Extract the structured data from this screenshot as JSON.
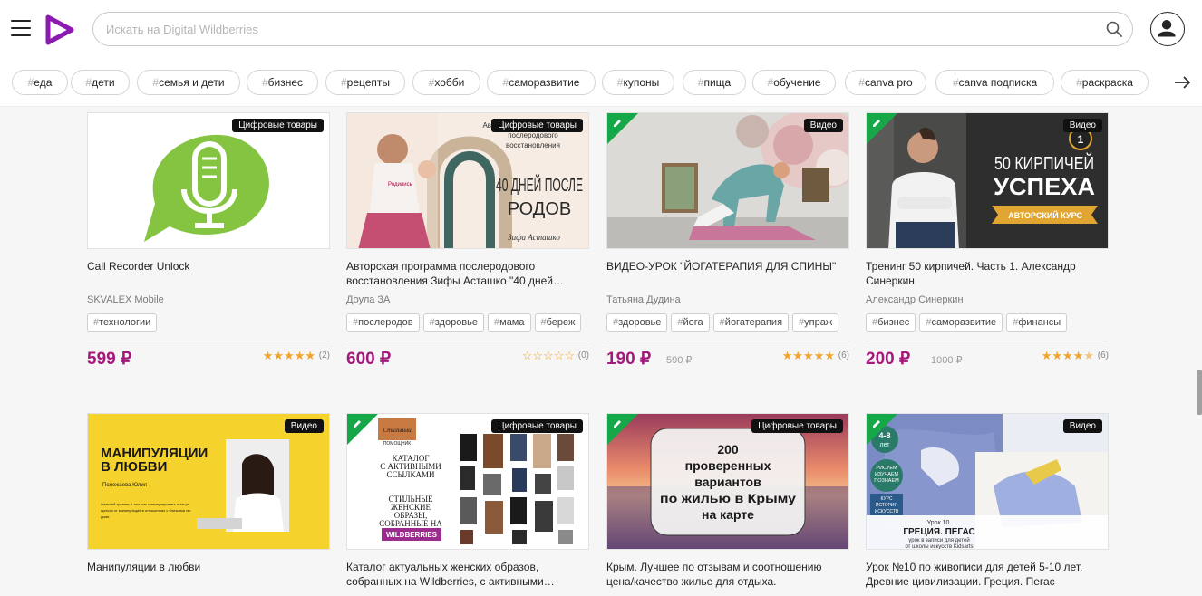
{
  "header": {
    "search_placeholder": "Искать на Digital Wildberries"
  },
  "tags": [
    "еда",
    "дети",
    "семья и дети",
    "бизнес",
    "рецепты",
    "хобби",
    "саморазвитие",
    "купоны",
    "пища",
    "обучение",
    "canva pro",
    "canva подписка",
    "раскраска"
  ],
  "tag_hash": "#",
  "colors": {
    "brand": "#a5197d",
    "logo": "#8b1bb0",
    "new_corner": "#15a748",
    "star": "#f0a42b"
  },
  "cards": [
    {
      "badge": "Цифровые товары",
      "title": "Call Recorder Unlock",
      "author": "SKVALEX Mobile",
      "tags": [
        "технологии"
      ],
      "price": "599 ₽",
      "old_price": "",
      "rating": 5,
      "reviews": "(2)",
      "is_new": false
    },
    {
      "badge": "Цифровые товары",
      "title": "Авторская программа послеродового восстановления Зифы Асташко \"40 дней…",
      "author": "Доула ЗА",
      "tags": [
        "послеродов",
        "здоровье",
        "мама",
        "береж"
      ],
      "price": "600 ₽",
      "old_price": "",
      "rating": 0,
      "reviews": "(0)",
      "is_new": false,
      "thumb_text": {
        "top": "Авторская программа послеродового восстановления",
        "main1": "40 ДНЕЙ ПОСЛЕ",
        "main2": "РОДОВ",
        "sign": "Зифа Асташко",
        "shirt": "Родились"
      }
    },
    {
      "badge": "Видео",
      "title": "ВИДЕО-УРОК \"ЙОГАТЕРАПИЯ ДЛЯ СПИНЫ\"",
      "author": "Татьяна Дудина",
      "tags": [
        "здоровье",
        "йога",
        "йогатерапия",
        "упраж"
      ],
      "price": "190 ₽",
      "old_price": "590 ₽",
      "rating": 5,
      "reviews": "(6)",
      "is_new": true
    },
    {
      "badge": "Видео",
      "title": "Тренинг 50 кирпичей. Часть 1. Александр Синеркин",
      "author": "Александр Синеркин",
      "tags": [
        "бизнес",
        "саморазвитие",
        "финансы"
      ],
      "price": "200 ₽",
      "old_price": "1000 ₽",
      "rating": 4.5,
      "reviews": "(6)",
      "is_new": true,
      "thumb_text": {
        "line1": "50 КИРПИЧЕЙ",
        "line2": "УСПЕХА",
        "ribbon": "АВТОРСКИЙ КУРС",
        "num": "1"
      }
    },
    {
      "badge": "Видео",
      "title": "Манипуляции в любви",
      "author": "",
      "tags": [],
      "price": "",
      "old_price": "",
      "rating": null,
      "reviews": "",
      "is_new": false,
      "thumb_text": {
        "line1": "МАНИПУЛЯЦИИ",
        "line2": "В ЛЮБВИ",
        "name": "Полежаева Юлия",
        "desc": "Женский тренинг о том, как манипулировать и защищаться от манипуляций в отношениях с близкими людьми"
      }
    },
    {
      "badge": "Цифровые товары",
      "title": "Каталог актуальных женских образов, собранных на Wildberries, с активными…",
      "author": "",
      "tags": [],
      "price": "",
      "old_price": "",
      "rating": null,
      "reviews": "",
      "is_new": true,
      "thumb_text": {
        "logo1": "Стильный",
        "logo2": "ПОМОЩНИК",
        "l1": "КАТАЛОГ",
        "l2": "С АКТИВНЫМИ",
        "l3": "ССЫЛКАМИ",
        "s1": "СТИЛЬНЫЕ",
        "s2": "ЖЕНСКИЕ",
        "s3": "ОБРАЗЫ,",
        "s4": "СОБРАННЫЕ НА",
        "wb": "WILDBERRIES"
      }
    },
    {
      "badge": "Цифровые товары",
      "title": "Крым. Лучшее по отзывам и соотношению цена/качество жилье для отдыха.",
      "author": "",
      "tags": [],
      "price": "",
      "old_price": "",
      "rating": null,
      "reviews": "",
      "is_new": true,
      "thumb_text": {
        "l1": "200",
        "l2": "проверенных",
        "l3": "вариантов",
        "l4": "по жилью в Крыму",
        "l5": "на карте"
      }
    },
    {
      "badge": "Видео",
      "title": "Урок №10 по живописи для детей 5-10 лет. Древние цивилизации. Греция. Пегас",
      "author": "",
      "tags": [],
      "price": "",
      "old_price": "",
      "rating": null,
      "reviews": "",
      "is_new": true,
      "thumb_text": {
        "age1": "4-8",
        "age2": "лет",
        "c1": "РИСУЕМ",
        "c2": "ИЗУЧАЕМ",
        "c3": "ПОЗНАЕМ",
        "k1": "КУРС",
        "k2": "ИСТОРИЯ",
        "k3": "ИСКУССТВ",
        "u1": "Урок 10.",
        "u2": "ГРЕЦИЯ. ПЕГАС",
        "u3": "урок в записи для детей",
        "u4": "от школы искусств Kidsarts"
      }
    }
  ]
}
